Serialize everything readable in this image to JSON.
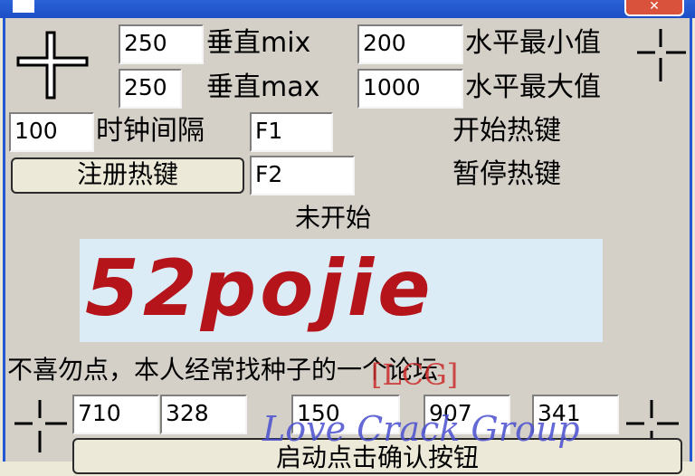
{
  "window": {
    "title": "",
    "close_label": "✕"
  },
  "top": {
    "v_min_value": "250",
    "v_min_label": "垂直mix",
    "h_min_value": "200",
    "h_min_label": "水平最小值",
    "v_max_value": "250",
    "v_max_label": "垂直max",
    "h_max_value": "1000",
    "h_max_label": "水平最大值"
  },
  "timer": {
    "value": "100",
    "label": "时钟间隔"
  },
  "hotkeys": {
    "start_value": "F1",
    "start_label": "开始热键",
    "pause_value": "F2",
    "pause_label": "暂停热键",
    "register_button": "注册热键"
  },
  "status": {
    "text": "未开始"
  },
  "banner": {
    "logo": "52pojie"
  },
  "notice": {
    "text": "不喜勿点，本人经常找种子的一个论坛"
  },
  "coords": {
    "field1": "710",
    "field2": "328",
    "field3": "150",
    "field4": "907",
    "field5": "341"
  },
  "bottom": {
    "start_button": "启动点击确认按钮"
  },
  "watermark": {
    "tag": "[LCG]",
    "name": "Love Crack Group"
  }
}
